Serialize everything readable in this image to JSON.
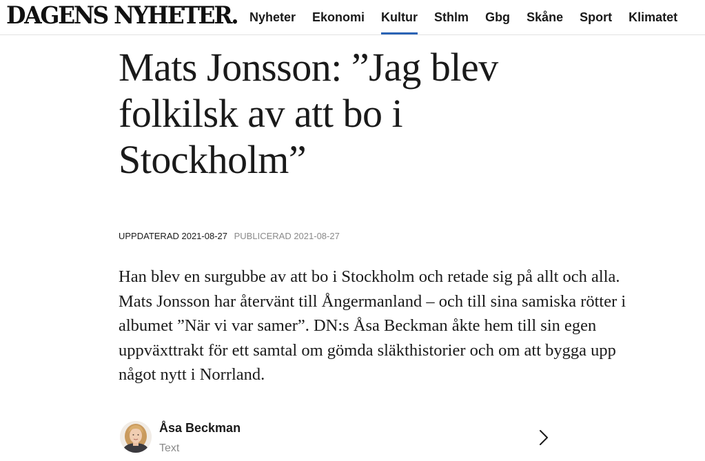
{
  "site": {
    "logo_text": "DAGENS NYHETER."
  },
  "nav": {
    "items": [
      {
        "label": "Nyheter"
      },
      {
        "label": "Ekonomi"
      },
      {
        "label": "Kultur",
        "active": true
      },
      {
        "label": "Sthlm"
      },
      {
        "label": "Gbg"
      },
      {
        "label": "Skåne"
      },
      {
        "label": "Sport"
      },
      {
        "label": "Klimatet"
      }
    ],
    "active_color": "#2a63b5"
  },
  "article": {
    "headline": "Mats Jonsson: ”Jag blev folkilsk av att bo i Stockholm”",
    "updated": "UPPDATERAD 2021-08-27",
    "published": "PUBLICERAD 2021-08-27",
    "lede": "Han blev en surgubbe av att bo i Stockholm och retade sig på allt och alla. Mats Jonsson har återvänt till Ångermanland – och till sina samiska rötter i albumet ”När vi var samer”. DN:s Åsa Beckman åkte hem till sin egen uppväxttrakt för ett samtal om gömda släkthistorier och om att bygga upp något nytt i Norrland."
  },
  "byline": {
    "author_name": "Åsa Beckman",
    "author_role": "Text",
    "avatar_icon": "author-portrait",
    "expand_icon": "chevron-right-icon"
  }
}
